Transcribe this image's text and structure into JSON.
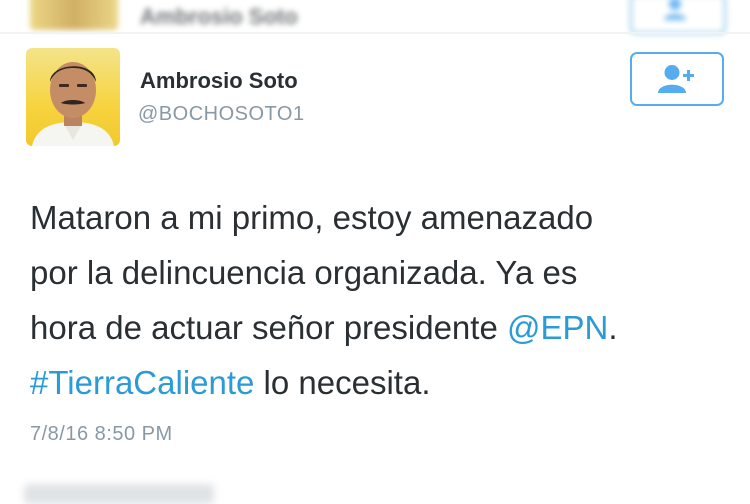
{
  "previous_tweet": {
    "name": "Ambrosio Soto"
  },
  "tweet": {
    "author_name": "Ambrosio Soto",
    "handle": "@BOCHOSOTO1",
    "text_lines": [
      "Mataron a mi primo, estoy amenazado",
      "por la delincuencia organizada. Ya es",
      "hora de actuar señor presidente ",
      " lo necesita."
    ],
    "mention": "@EPN",
    "line3_end": ".",
    "hashtag": "#TierraCaliente",
    "timestamp": "7/8/16 8:50 PM"
  },
  "follow_button": {
    "icon": "add-user-icon"
  },
  "colors": {
    "accent": "#55acee",
    "link": "#2b9bd6",
    "text": "#292f33",
    "muted": "#8899a6",
    "avatar_bg": "#f7d33e"
  }
}
